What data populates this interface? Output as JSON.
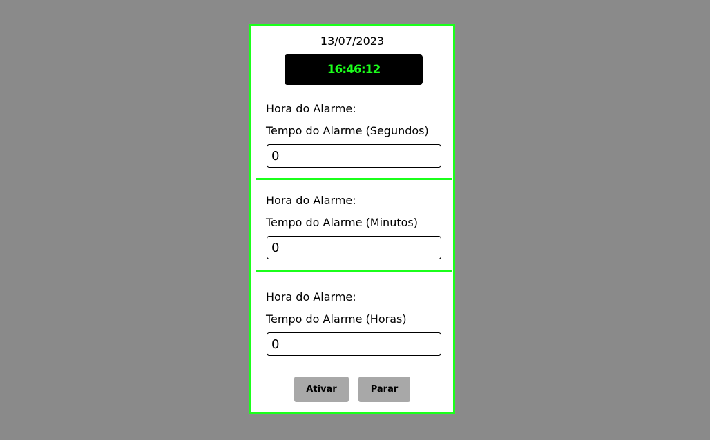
{
  "date": "13/07/2023",
  "clock": "16:46:12",
  "sections": [
    {
      "hora_label": "Hora do Alarme:",
      "tempo_label": "Tempo do Alarme (Segundos)",
      "value": "0"
    },
    {
      "hora_label": "Hora do Alarme:",
      "tempo_label": "Tempo do Alarme (Minutos)",
      "value": "0"
    },
    {
      "hora_label": "Hora do Alarme:",
      "tempo_label": "Tempo do Alarme (Horas)",
      "value": "0"
    }
  ],
  "buttons": {
    "activate": "Ativar",
    "stop": "Parar"
  },
  "colors": {
    "accent": "#1bff1b",
    "background": "#8a8a8a",
    "button": "#a8a8a8"
  }
}
